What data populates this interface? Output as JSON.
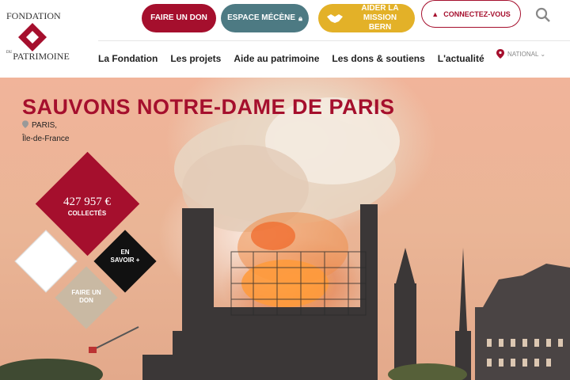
{
  "logo": {
    "top": "FONDATION",
    "bottom_small": "DU",
    "bottom": "PATRIMOINE"
  },
  "header": {
    "buttons": {
      "donate": "FAIRE UN DON",
      "patron": "ESPACE MÉCÈNE",
      "bern": "AIDER LA MISSION BERN",
      "login": "CONNECTEZ-VOUS"
    },
    "nav": [
      "La Fondation",
      "Les projets",
      "Aide au patrimoine",
      "Les dons & soutiens",
      "L'actualité"
    ],
    "region": "NATIONAL"
  },
  "hero": {
    "title": "SAUVONS NOTRE-DAME DE PARIS",
    "city": "PARIS,",
    "region": "Île-de-France",
    "amount": "427 957 €",
    "amount_label": "COLLECTÉS",
    "learn_more": "EN SAVOIR +",
    "donate": "FAIRE UN DON"
  },
  "colors": {
    "brand": "#a50f2d",
    "patron": "#4d7a83",
    "bern": "#e3b128",
    "donate_diamond": "#c9b9a3"
  },
  "icons": [
    "logo-diamond-icon",
    "lock-icon",
    "handshake-icon",
    "user-icon",
    "search-icon",
    "map-pin-icon",
    "chevron-down-icon"
  ]
}
